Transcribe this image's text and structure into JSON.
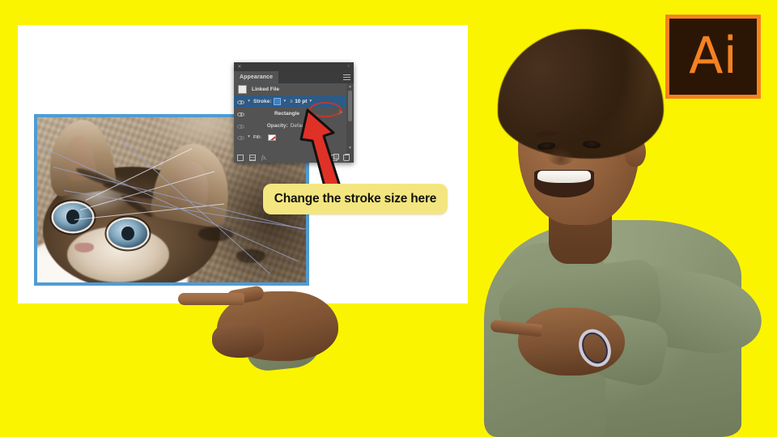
{
  "background": {
    "color": "#fbf400"
  },
  "artboard": {
    "color": "#ffffff"
  },
  "photo": {
    "subject": "kitten-photo",
    "stroke_color": "#4f9cd4",
    "alt": "Close-up photo of a tabby kitten lying on a blanket"
  },
  "panel": {
    "title": "Appearance",
    "close_icon": "✕",
    "collapse_icon": "«",
    "menu_icon": "hamburger-menu-icon",
    "scrollbar": {
      "up_icon": "▲",
      "down_icon": "▼"
    },
    "rows": [
      {
        "id": "linked-file",
        "label": "Linked File",
        "has_eye": false,
        "has_thumbnail": true
      },
      {
        "id": "stroke",
        "label": "Stroke:",
        "selected": true,
        "has_eye": true,
        "swatch_color": "#3d7ec4",
        "weight_icon": "stroke-weight-icon",
        "value": "10 pt",
        "chevron": "∨",
        "highlight_color": "#c0392b"
      },
      {
        "id": "rectangle",
        "label": "Rectangle",
        "has_eye": true,
        "fx": "fx"
      },
      {
        "id": "opacity",
        "label": "Opacity:",
        "value": "Default",
        "has_eye": true
      },
      {
        "id": "fill",
        "label": "Fill:",
        "has_eye": true,
        "swatch": "none-swatch"
      }
    ],
    "footer_icons": [
      "add-new-stroke-icon",
      "add-new-fill-icon",
      "add-new-effect-icon",
      "clear-appearance-icon",
      "duplicate-item-icon",
      "delete-item-icon"
    ]
  },
  "annotation": {
    "arrow": {
      "name": "red-arrow",
      "color": "#e03127",
      "outline": "#111111"
    },
    "callout_text": "Change the stroke size here",
    "callout_bg": "#f3e680"
  },
  "logo": {
    "text": "Ai",
    "name": "adobe-illustrator-logo",
    "bg": "#2b1606",
    "accent": "#f58220"
  },
  "person": {
    "name": "presenter-photo",
    "shirt_color": "#828e6c",
    "description": "Smiling young man with curly hair pointing with both hands"
  }
}
